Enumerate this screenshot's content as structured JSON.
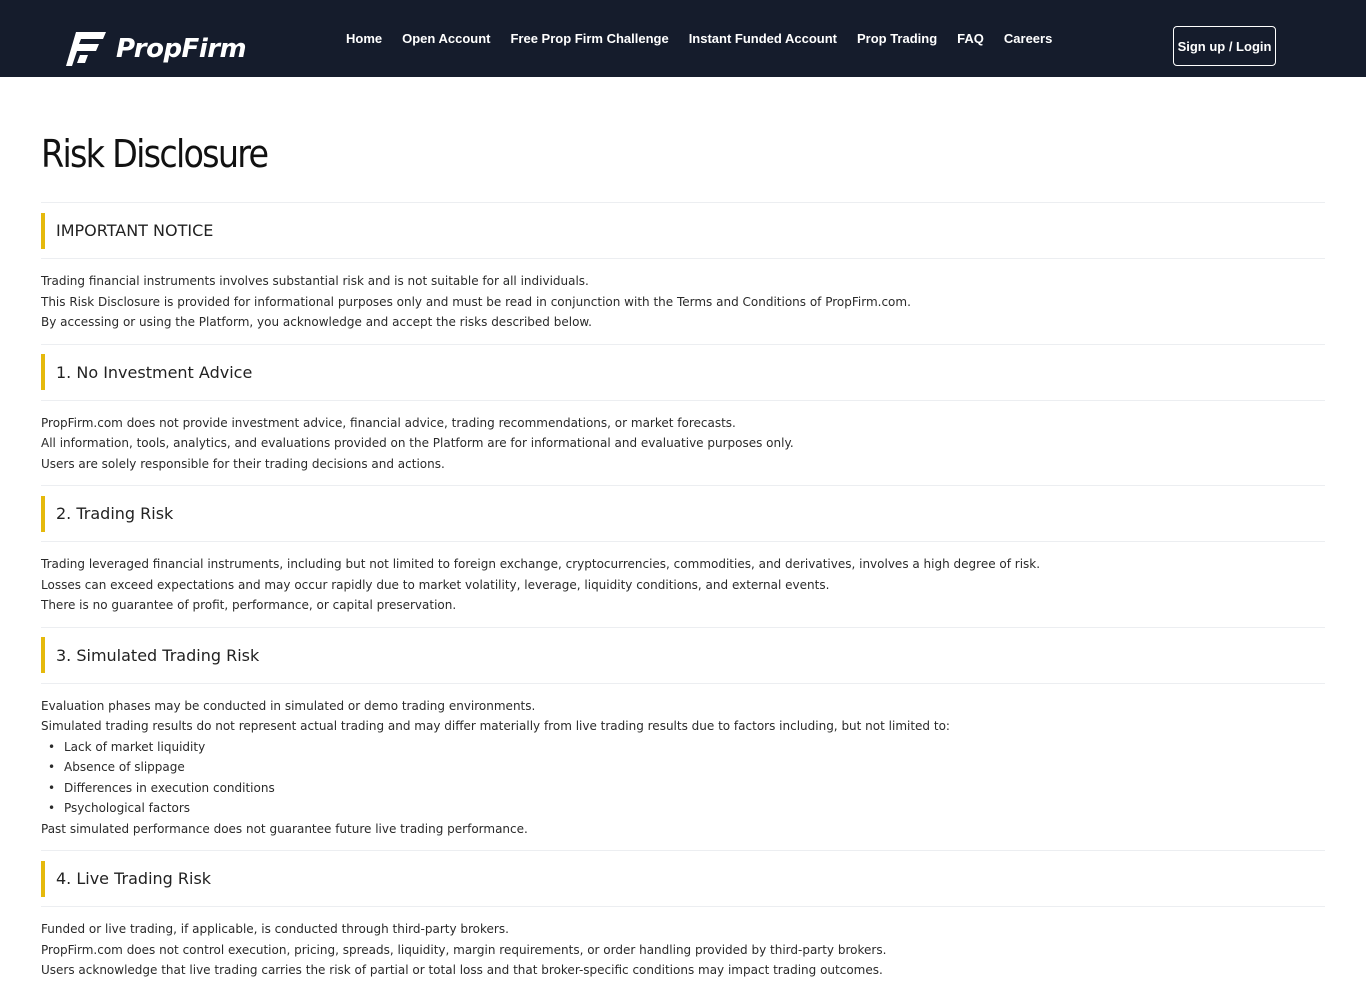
{
  "header": {
    "logo_text": "PropFirm",
    "logo_icon": "propfirm-logo-icon",
    "nav": [
      {
        "label": "Home"
      },
      {
        "label": "Open Account"
      },
      {
        "label": "Free Prop Firm Challenge"
      },
      {
        "label": "Instant Funded Account"
      },
      {
        "label": "Prop Trading"
      },
      {
        "label": "FAQ"
      },
      {
        "label": "Careers"
      }
    ],
    "signup_label": "Sign up / Login"
  },
  "page": {
    "title": "Risk Disclosure",
    "sections": [
      {
        "heading": "IMPORTANT NOTICE",
        "paragraphs": [
          "Trading financial instruments involves substantial risk and is not suitable for all individuals.",
          "This Risk Disclosure is provided for informational purposes only and must be read in conjunction with the Terms and Conditions of PropFirm.com.",
          "By accessing or using the Platform, you acknowledge and accept the risks described below."
        ]
      },
      {
        "heading": "1. No Investment Advice",
        "paragraphs": [
          "PropFirm.com does not provide investment advice, financial advice, trading recommendations, or market forecasts.",
          "All information, tools, analytics, and evaluations provided on the Platform are for informational and evaluative purposes only.",
          "Users are solely responsible for their trading decisions and actions."
        ]
      },
      {
        "heading": "2. Trading Risk",
        "paragraphs": [
          "Trading leveraged financial instruments, including but not limited to foreign exchange, cryptocurrencies, commodities, and derivatives, involves a high degree of risk.",
          "Losses can exceed expectations and may occur rapidly due to market volatility, leverage, liquidity conditions, and external events.",
          "There is no guarantee of profit, performance, or capital preservation."
        ]
      },
      {
        "heading": "3. Simulated Trading Risk",
        "paragraphs": [
          "Evaluation phases may be conducted in simulated or demo trading environments.",
          "Simulated trading results do not represent actual trading and may differ materially from live trading results due to factors including, but not limited to:"
        ],
        "bullets": [
          "Lack of market liquidity",
          "Absence of slippage",
          "Differences in execution conditions",
          "Psychological factors"
        ],
        "closing": "Past simulated performance does not guarantee future live trading performance."
      },
      {
        "heading": "4. Live Trading Risk",
        "paragraphs": [
          "Funded or live trading, if applicable, is conducted through third-party brokers.",
          "PropFirm.com does not control execution, pricing, spreads, liquidity, margin requirements, or order handling provided by third-party brokers.",
          "Users acknowledge that live trading carries the risk of partial or total loss and that broker-specific conditions may impact trading outcomes."
        ]
      }
    ]
  },
  "colors": {
    "header_bg": "#151c2c",
    "accent": "#e5b90c"
  }
}
